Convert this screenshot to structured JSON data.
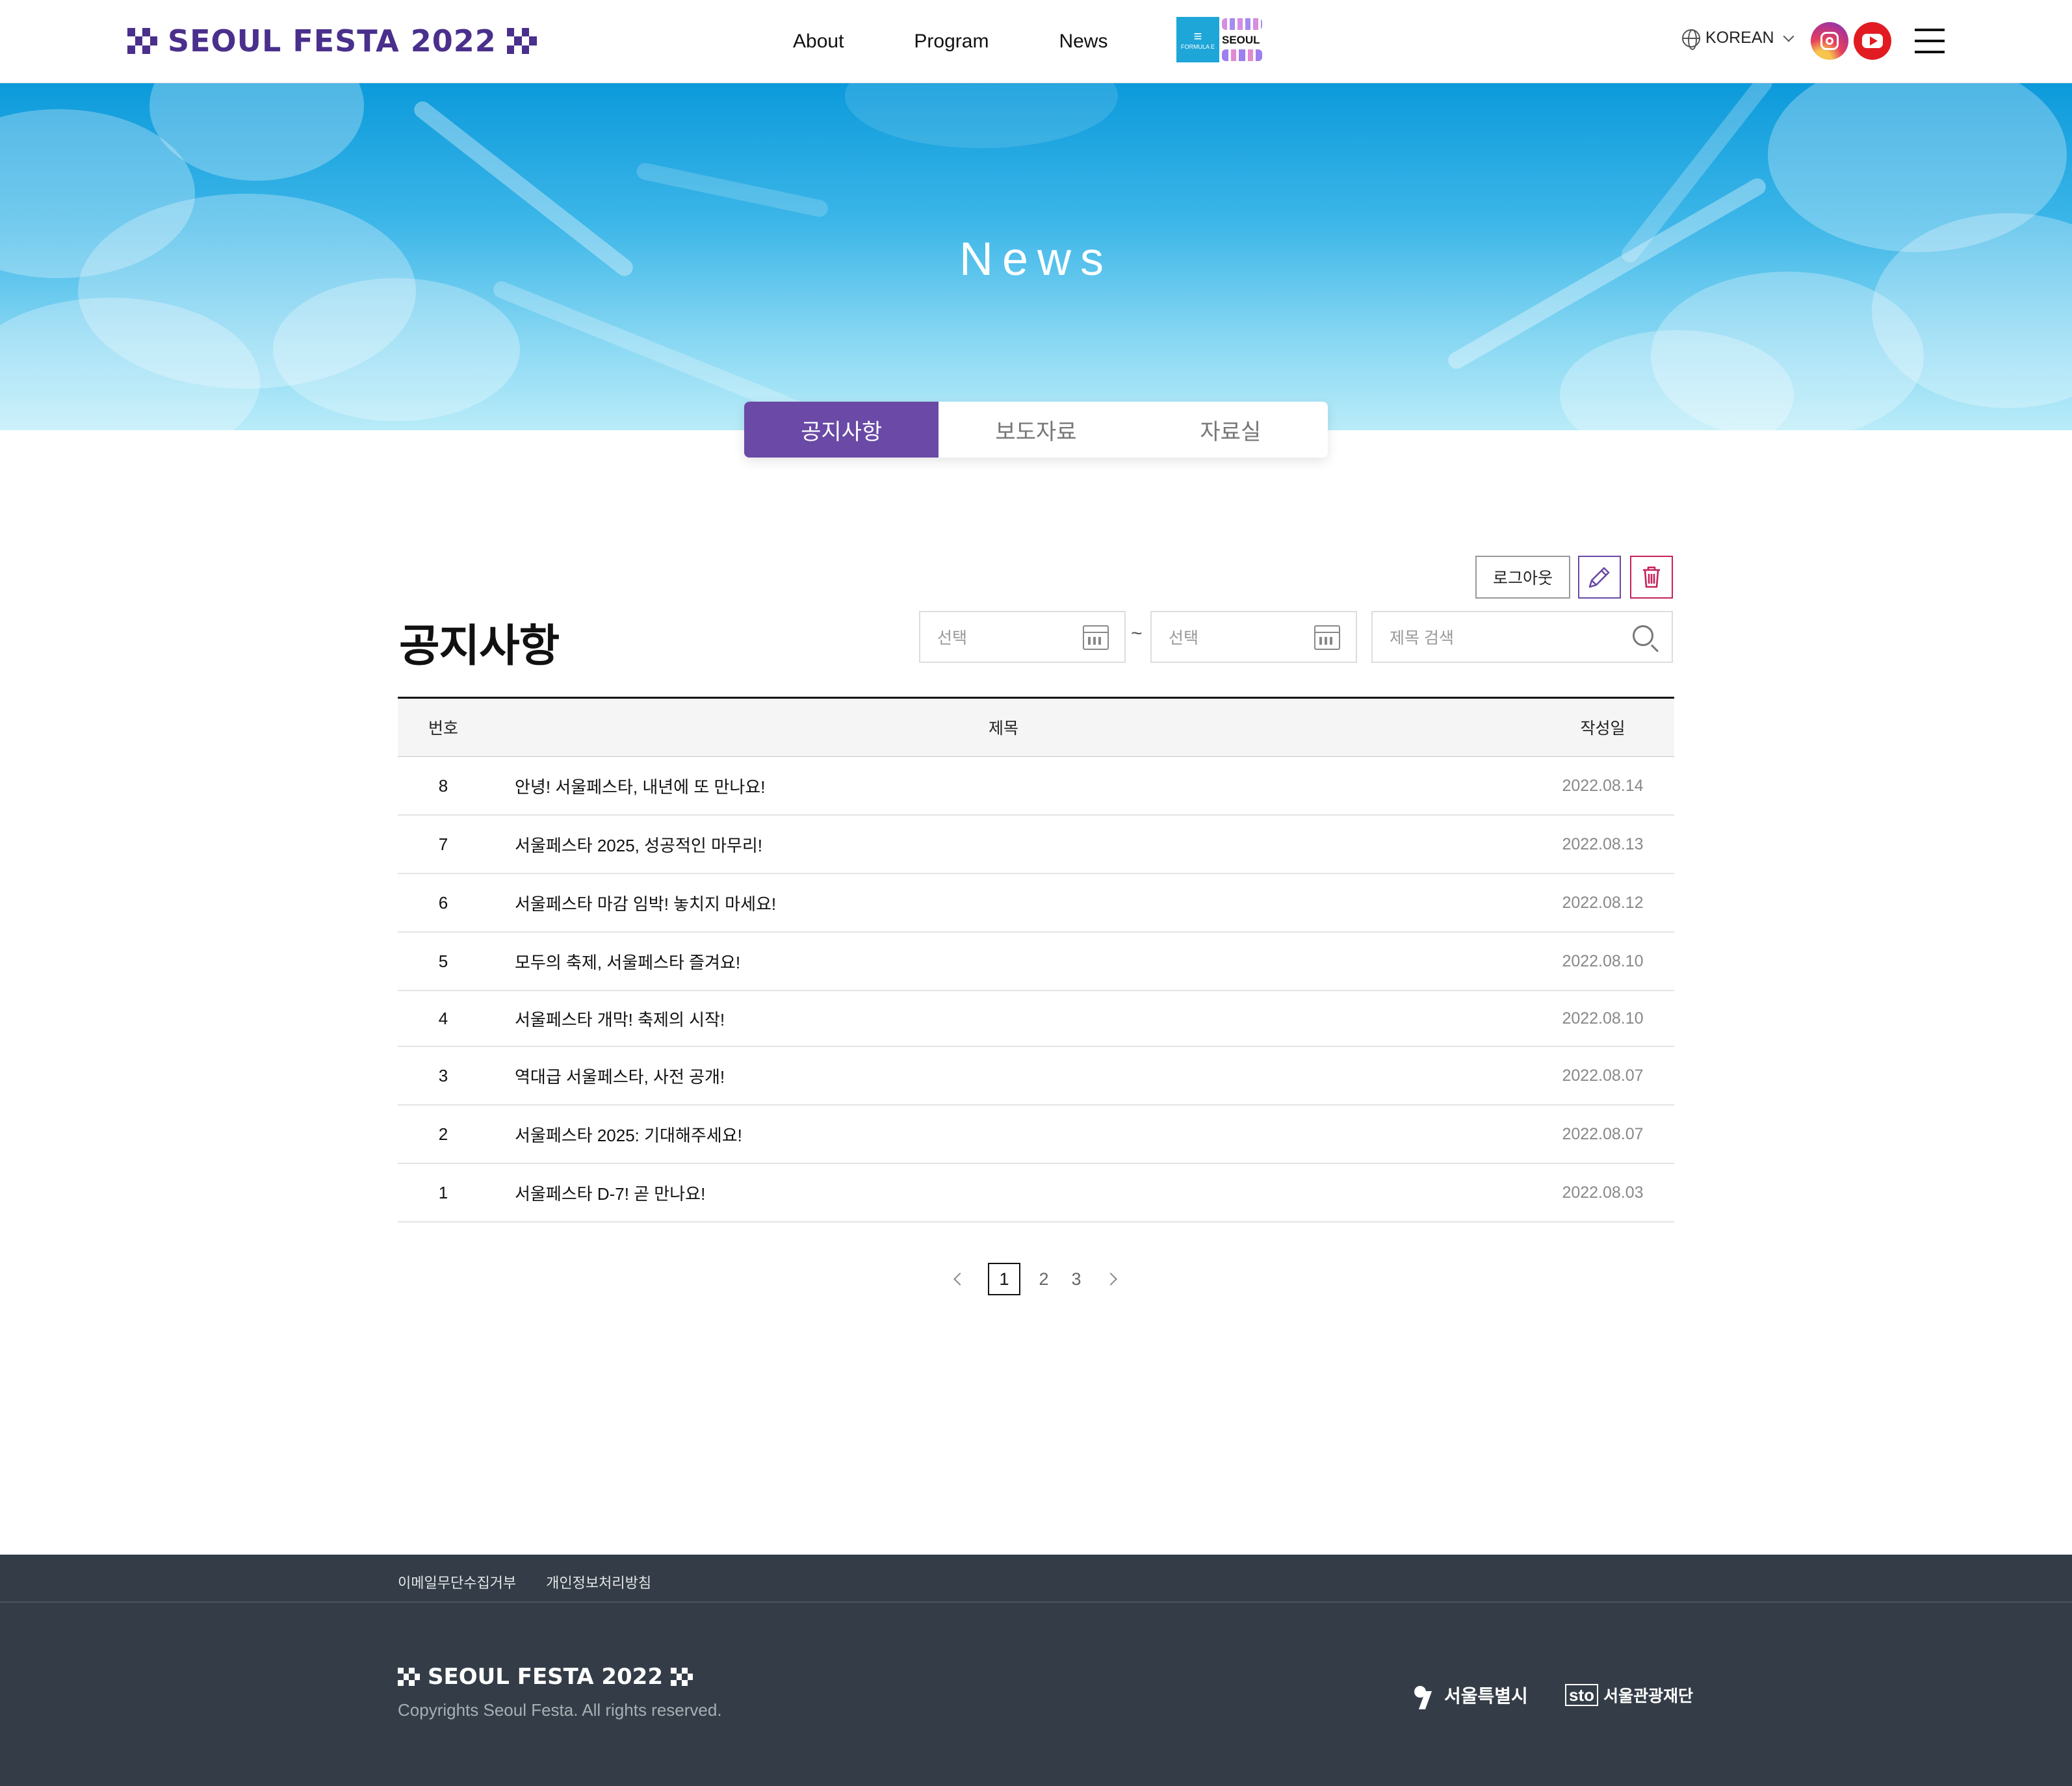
{
  "header": {
    "logo_text": "SEOUL FESTA 2022",
    "nav": [
      "About",
      "Program",
      "News"
    ],
    "badge_left": "FORMULA E",
    "badge_right": "SEOUL",
    "language": "KOREAN",
    "brand_color": "#4a2f8c"
  },
  "hero": {
    "title": "News"
  },
  "tabs": [
    {
      "label": "공지사항",
      "active": true
    },
    {
      "label": "보도자료",
      "active": false
    },
    {
      "label": "자료실",
      "active": false
    }
  ],
  "board": {
    "title": "공지사항",
    "logout_label": "로그아웃",
    "date_from_placeholder": "선택",
    "date_to_placeholder": "선택",
    "date_separator": "~",
    "search_placeholder": "제목 검색",
    "headers": {
      "num": "번호",
      "title": "제목",
      "date": "작성일"
    },
    "rows": [
      {
        "num": "8",
        "title": "안녕! 서울페스타, 내년에 또 만나요!",
        "date": "2022.08.14"
      },
      {
        "num": "7",
        "title": "서울페스타 2025, 성공적인 마무리!",
        "date": "2022.08.13"
      },
      {
        "num": "6",
        "title": "서울페스타 마감 임박! 놓치지 마세요!",
        "date": "2022.08.12"
      },
      {
        "num": "5",
        "title": "모두의 축제, 서울페스타 즐겨요!",
        "date": "2022.08.10"
      },
      {
        "num": "4",
        "title": "서울페스타 개막! 축제의 시작!",
        "date": "2022.08.10"
      },
      {
        "num": "3",
        "title": "역대급 서울페스타, 사전 공개!",
        "date": "2022.08.07"
      },
      {
        "num": "2",
        "title": "서울페스타 2025: 기대해주세요!",
        "date": "2022.08.07"
      },
      {
        "num": "1",
        "title": "서울페스타 D-7! 곧 만나요!",
        "date": "2022.08.03"
      }
    ]
  },
  "pagination": {
    "pages": [
      "1",
      "2",
      "3"
    ],
    "current": "1"
  },
  "footer": {
    "links": [
      "이메일무단수집거부",
      "개인정보처리방침"
    ],
    "logo_text": "SEOUL FESTA 2022",
    "copyright": "Copyrights Seoul Festa. All rights reserved.",
    "partner1": "서울특별시",
    "partner2_mark": "sto",
    "partner2": "서울관광재단"
  },
  "colors": {
    "accent": "#6a4aa6",
    "delete": "#c5215c",
    "footer_bg": "#343d47"
  },
  "icons": [
    "globe-icon",
    "chevron-down-icon",
    "instagram-icon",
    "youtube-icon",
    "menu-icon",
    "pencil-icon",
    "trash-icon",
    "calendar-icon",
    "search-icon",
    "chevron-left-icon",
    "chevron-right-icon"
  ]
}
